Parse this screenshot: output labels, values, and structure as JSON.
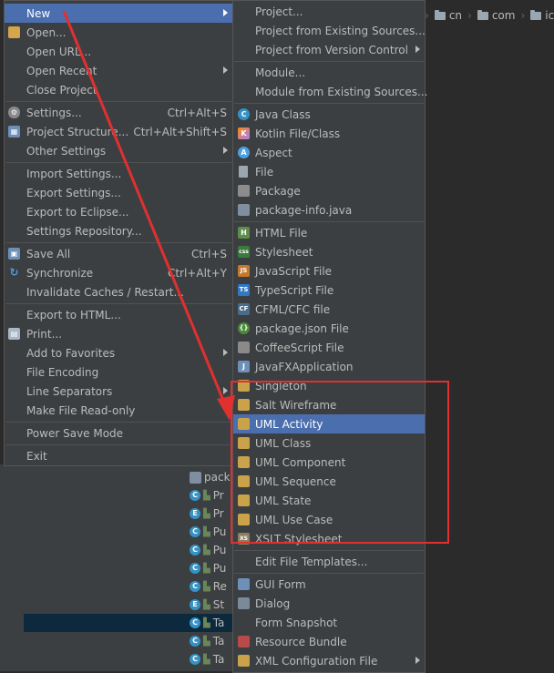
{
  "breadcrumb": [
    "cn",
    "com",
    "ic"
  ],
  "tree": {
    "rows": [
      {
        "badge": "",
        "text": "pack"
      },
      {
        "badge": "C",
        "text": "Pr"
      },
      {
        "badge": "E",
        "text": "Pr"
      },
      {
        "badge": "C",
        "text": "Pu"
      },
      {
        "badge": "C",
        "text": "Pu"
      },
      {
        "badge": "C",
        "text": "Pu"
      },
      {
        "badge": "C",
        "text": "Re"
      },
      {
        "badge": "E",
        "text": "St"
      },
      {
        "badge": "C",
        "text": "Ta"
      },
      {
        "badge": "C",
        "text": "Ta"
      },
      {
        "badge": "C",
        "text": "Ta"
      }
    ]
  },
  "file_menu": {
    "items": [
      {
        "label": "New",
        "shortcut": "",
        "submenu": true
      },
      {
        "label": "Open...",
        "shortcut": "",
        "icon": "folder-icon"
      },
      {
        "label": "Open URL...",
        "shortcut": ""
      },
      {
        "label": "Open Recent",
        "shortcut": "",
        "submenu": true
      },
      {
        "label": "Close Project",
        "shortcut": ""
      },
      {
        "label": "Settings...",
        "shortcut": "Ctrl+Alt+S",
        "icon": "wrench-icon"
      },
      {
        "label": "Project Structure...",
        "shortcut": "Ctrl+Alt+Shift+S",
        "icon": "project-structure-icon"
      },
      {
        "label": "Other Settings",
        "shortcut": "",
        "submenu": true
      },
      {
        "label": "Import Settings...",
        "shortcut": ""
      },
      {
        "label": "Export Settings...",
        "shortcut": ""
      },
      {
        "label": "Export to Eclipse...",
        "shortcut": ""
      },
      {
        "label": "Settings Repository...",
        "shortcut": ""
      },
      {
        "label": "Save All",
        "shortcut": "Ctrl+S",
        "icon": "save-icon"
      },
      {
        "label": "Synchronize",
        "shortcut": "Ctrl+Alt+Y",
        "icon": "sync-icon"
      },
      {
        "label": "Invalidate Caches / Restart...",
        "shortcut": ""
      },
      {
        "label": "Export to HTML...",
        "shortcut": ""
      },
      {
        "label": "Print...",
        "shortcut": "",
        "icon": "print-icon"
      },
      {
        "label": "Add to Favorites",
        "shortcut": "",
        "submenu": true
      },
      {
        "label": "File Encoding",
        "shortcut": ""
      },
      {
        "label": "Line Separators",
        "shortcut": "",
        "submenu": true
      },
      {
        "label": "Make File Read-only",
        "shortcut": ""
      },
      {
        "label": "Power Save Mode",
        "shortcut": ""
      },
      {
        "label": "Exit",
        "shortcut": ""
      }
    ]
  },
  "new_menu": {
    "items": [
      {
        "label": "Project...",
        "icon": ""
      },
      {
        "label": "Project from Existing Sources...",
        "icon": ""
      },
      {
        "label": "Project from Version Control",
        "icon": "",
        "submenu": true
      },
      {
        "label": "Module...",
        "icon": ""
      },
      {
        "label": "Module from Existing Sources...",
        "icon": ""
      },
      {
        "label": "Java Class",
        "icon": "C"
      },
      {
        "label": "Kotlin File/Class",
        "icon": "K"
      },
      {
        "label": "Aspect",
        "icon": "A"
      },
      {
        "label": "File",
        "icon": ""
      },
      {
        "label": "Package",
        "icon": ""
      },
      {
        "label": "package-info.java",
        "icon": ""
      },
      {
        "label": "HTML File",
        "icon": "H"
      },
      {
        "label": "Stylesheet",
        "icon": "css"
      },
      {
        "label": "JavaScript File",
        "icon": "JS"
      },
      {
        "label": "TypeScript File",
        "icon": "TS"
      },
      {
        "label": "CFML/CFC file",
        "icon": "CF"
      },
      {
        "label": "package.json File",
        "icon": "{}"
      },
      {
        "label": "CoffeeScript File",
        "icon": ""
      },
      {
        "label": "JavaFXApplication",
        "icon": "J"
      },
      {
        "label": "Singleton",
        "icon": ""
      },
      {
        "label": "Salt Wireframe",
        "icon": ""
      },
      {
        "label": "UML Activity",
        "icon": ""
      },
      {
        "label": "UML Class",
        "icon": ""
      },
      {
        "label": "UML Component",
        "icon": ""
      },
      {
        "label": "UML Sequence",
        "icon": ""
      },
      {
        "label": "UML State",
        "icon": ""
      },
      {
        "label": "UML Use Case",
        "icon": ""
      },
      {
        "label": "XSLT Stylesheet",
        "icon": "XS"
      },
      {
        "label": "Edit File Templates...",
        "icon": ""
      },
      {
        "label": "GUI Form",
        "icon": ""
      },
      {
        "label": "Dialog",
        "icon": ""
      },
      {
        "label": "Form Snapshot",
        "icon": ""
      },
      {
        "label": "Resource Bundle",
        "icon": ""
      },
      {
        "label": "XML Configuration File",
        "icon": "",
        "submenu": true
      }
    ]
  },
  "colors": {
    "highlight": "#4b6eaf",
    "annotation_red": "#e03030"
  }
}
